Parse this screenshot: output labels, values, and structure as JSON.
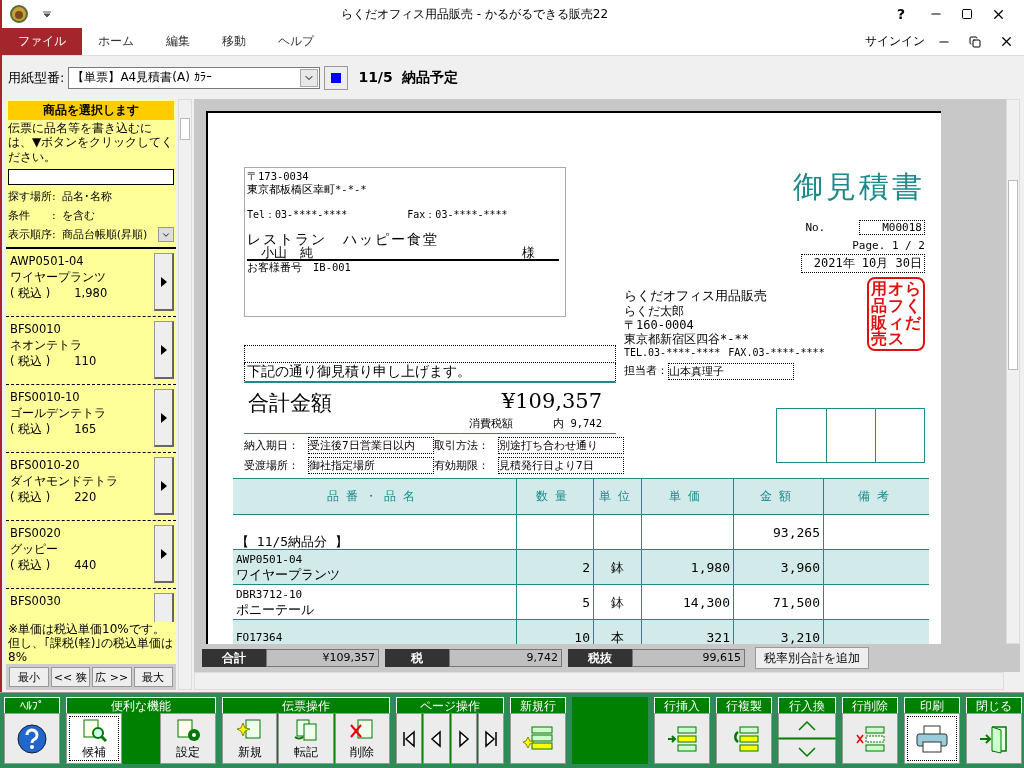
{
  "window": {
    "title": "らくだオフィス用品販売 - かるがるできる販売22",
    "help": "?"
  },
  "menu": [
    {
      "label": "ファイル",
      "selected": true
    },
    {
      "label": "ホーム",
      "selected": false
    },
    {
      "label": "編集",
      "selected": false
    },
    {
      "label": "移動",
      "selected": false
    },
    {
      "label": "ヘルプ",
      "selected": false
    }
  ],
  "signin": "サインイン",
  "form_bar": {
    "label": "用紙型番:",
    "value": "【単票】A4見積書(A) ｶﾗｰ",
    "heading": "11/5  納品予定"
  },
  "product_panel": {
    "title": "商品を選択します",
    "instructions": "伝票に品名等を書き込むには、▼ボタンをクリックしてください。",
    "filters": [
      {
        "label": "探す場所:",
        "value": "品名･名称",
        "kind": "text"
      },
      {
        "label": "条件　　:",
        "value": "を含む",
        "kind": "text"
      },
      {
        "label": "表示順序:",
        "value": "商品台帳順(昇順)",
        "kind": "select"
      }
    ],
    "products": [
      {
        "code": "AWP0501-04",
        "name": "ワイヤープランツ",
        "tax": "( 税込 )",
        "price": "1,980"
      },
      {
        "code": "BFS0010",
        "name": "ネオンテトラ",
        "tax": "( 税込 )",
        "price": "110"
      },
      {
        "code": "BFS0010-10",
        "name": "ゴールデンテトラ",
        "tax": "( 税込 )",
        "price": "165"
      },
      {
        "code": "BFS0010-20",
        "name": "ダイヤモンドテトラ",
        "tax": "( 税込 )",
        "price": "220"
      },
      {
        "code": "BFS0020",
        "name": "グッピー",
        "tax": "( 税込 )",
        "price": "440"
      },
      {
        "code": "BFS0030"
      }
    ],
    "notes": [
      "※単価は税込単価10%です。",
      "但し、｢課税(軽)｣の税込単価は8%"
    ],
    "size_buttons": [
      "最小",
      "<< 狭",
      "広 >>",
      "最大"
    ]
  },
  "document": {
    "customer": {
      "postal": "〒173-0034",
      "address": "東京都板橋区幸町*-*-*",
      "tel": "Tel：03-****-****",
      "fax": "Fax：03-****-****",
      "name": "レストラン　ハッピー食堂",
      "contact": "小山　純",
      "honorific": "様",
      "customer_no": "お客様番号　IB-001"
    },
    "title": "御見積書",
    "no_label": "No.",
    "no": "M00018",
    "page": "Page. 1 / 2",
    "date": "2021年 10月 30日",
    "company": {
      "name": "らくだオフィス用品販売",
      "person": "らくだ太郎",
      "postal": "〒160-0004",
      "address": "東京都新宿区四谷*-**",
      "tel": "TEL.03-****-****",
      "fax": "FAX.03-****-****"
    },
    "stamp": [
      "用品販売",
      "オフィス",
      "らくだ"
    ],
    "message": "下記の通り御見積り申し上げます。",
    "staff_label": "担当者：",
    "staff": "山本真理子",
    "total_label": "合計金額",
    "total": "¥109,357",
    "tax_label": "消費税額",
    "tax": "内 9,742",
    "terms": [
      {
        "label": "納入期日：",
        "value": "受注後7日営業日以内"
      },
      {
        "label": "取引方法：",
        "value": "別途打ち合わせ通り"
      },
      {
        "label": "受渡場所：",
        "value": "御社指定場所"
      },
      {
        "label": "有効期限：",
        "value": "見積発行日より7日"
      }
    ],
    "columns": [
      "品番・品名",
      "数量",
      "単位",
      "単価",
      "金額",
      "備考"
    ],
    "rows": [
      {
        "kind": "group",
        "label": "【 11/5納品分 】",
        "amount": "93,265"
      },
      {
        "kind": "item",
        "code": "AWP0501-04",
        "name": "ワイヤープランツ",
        "qty": "2",
        "unit": "鉢",
        "price": "1,980",
        "amount": "3,960"
      },
      {
        "kind": "item",
        "code": "DBR3712-10",
        "name": "ポニーテール",
        "qty": "5",
        "unit": "鉢",
        "price": "14,300",
        "amount": "71,500"
      },
      {
        "kind": "item",
        "code": "FO17364",
        "qty": "10",
        "unit": "本",
        "price": "321",
        "amount": "3,210"
      }
    ]
  },
  "summary": {
    "items": [
      {
        "label": "合計",
        "value": "¥109,357"
      },
      {
        "label": "税",
        "value": "9,742"
      },
      {
        "label": "税抜",
        "value": "99,615"
      }
    ],
    "button": "税率別合計を追加"
  },
  "toolbar": {
    "left": [
      {
        "title": "ﾍﾙﾌﾟ",
        "kind": "normal",
        "buttons": [
          {
            "kind": "help",
            "selected": false
          }
        ]
      },
      {
        "title": "便利な機能",
        "kind": "wide",
        "buttons": [
          {
            "kind": "candidate",
            "label": "候補",
            "selected": true
          },
          {
            "kind": "settings",
            "label": "設定",
            "selected": false
          }
        ]
      },
      {
        "title": "伝票操作",
        "kind": "normal",
        "buttons": [
          {
            "kind": "new",
            "label": "新規",
            "selected": false
          },
          {
            "kind": "transfer",
            "label": "転記",
            "selected": false
          },
          {
            "kind": "delete",
            "label": "削除",
            "selected": false
          }
        ]
      },
      {
        "title": "ページ操作",
        "kind": "nav",
        "buttons": [
          {
            "kind": "first",
            "selected": false
          },
          {
            "kind": "prev",
            "selected": false
          },
          {
            "kind": "next",
            "selected": false
          },
          {
            "kind": "last",
            "selected": false
          }
        ]
      },
      {
        "title": "新規行",
        "kind": "normal",
        "buttons": [
          {
            "kind": "new-row",
            "selected": false
          }
        ]
      }
    ],
    "right": [
      {
        "title": "行挿入",
        "kind": "normal",
        "buttons": [
          {
            "kind": "insert-row",
            "selected": false
          }
        ]
      },
      {
        "title": "行複製",
        "kind": "normal",
        "buttons": [
          {
            "kind": "copy-row",
            "selected": false
          }
        ]
      },
      {
        "title": "行入換",
        "kind": "stack",
        "buttons": [
          {
            "kind": "up",
            "selected": false
          },
          {
            "kind": "down",
            "selected": false
          }
        ]
      },
      {
        "title": "行削除",
        "kind": "normal",
        "buttons": [
          {
            "kind": "delete-row",
            "selected": false
          }
        ]
      },
      {
        "title": "印刷",
        "kind": "normal",
        "buttons": [
          {
            "kind": "print",
            "selected": true
          }
        ]
      },
      {
        "title": "閉じる",
        "kind": "normal",
        "buttons": [
          {
            "kind": "exit",
            "selected": false
          }
        ]
      }
    ]
  }
}
